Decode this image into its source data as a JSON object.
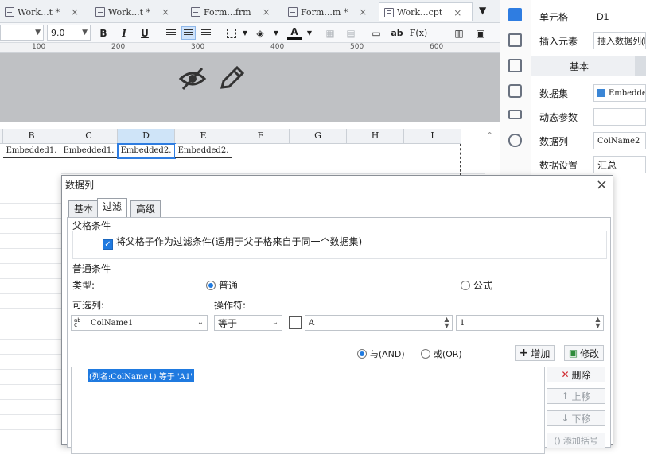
{
  "tabs": [
    {
      "label": "Work...t *",
      "close": "×"
    },
    {
      "label": "Work...t *",
      "close": "×"
    },
    {
      "label": "Form...frm",
      "close": "×"
    },
    {
      "label": "Form...m *",
      "close": "×"
    },
    {
      "label": "Work...cpt",
      "close": "×"
    }
  ],
  "toolbar": {
    "font_size": "9.0",
    "bold": "B",
    "italic": "I",
    "underline": "U",
    "text_color": "A",
    "ab": "ab",
    "fx": "F(x)"
  },
  "ruler": [
    "100",
    "200",
    "300",
    "400",
    "500",
    "600"
  ],
  "grid": {
    "columns": [
      "B",
      "C",
      "D",
      "E",
      "F",
      "G",
      "H",
      "I"
    ],
    "cells": [
      "Embedded1.",
      "Embedded1.",
      "Embedded2.",
      "Embedded2."
    ]
  },
  "right_panel": {
    "cell_label": "单元格",
    "cell_value": "D1",
    "insert_label": "插入元素",
    "insert_value": "插入数据列(D",
    "tab_basic": "基本",
    "dataset_label": "数据集",
    "dataset_value": "Embedded",
    "dynamic_label": "动态参数",
    "dynamic_value": "",
    "column_label": "数据列",
    "column_value": "ColName2",
    "setting_label": "数据设置",
    "setting_value": "汇总"
  },
  "dialog": {
    "title": "数据列",
    "close": "×",
    "tabs": [
      "基本",
      "过滤",
      "高级"
    ],
    "parent_section": "父格条件",
    "parent_checkbox": "将父格子作为过滤条件(适用于父子格来自于同一个数据集)",
    "normal_section": "普通条件",
    "type_label": "类型:",
    "type_normal": "普通",
    "type_formula": "公式",
    "optional_col_label": "可选列:",
    "operator_label": "操作符:",
    "column_select": "ColName1",
    "operator_select": "等于",
    "value_a": "A",
    "value_1": "1",
    "and_label": "与(AND)",
    "or_label": "或(OR)",
    "add_btn": "增加",
    "modify_btn": "修改",
    "delete_btn": "删除",
    "up_btn": "上移",
    "down_btn": "下移",
    "add_bracket_btn": "添加括号",
    "condition_item": "(列名:ColName1) 等于 'A1'"
  }
}
